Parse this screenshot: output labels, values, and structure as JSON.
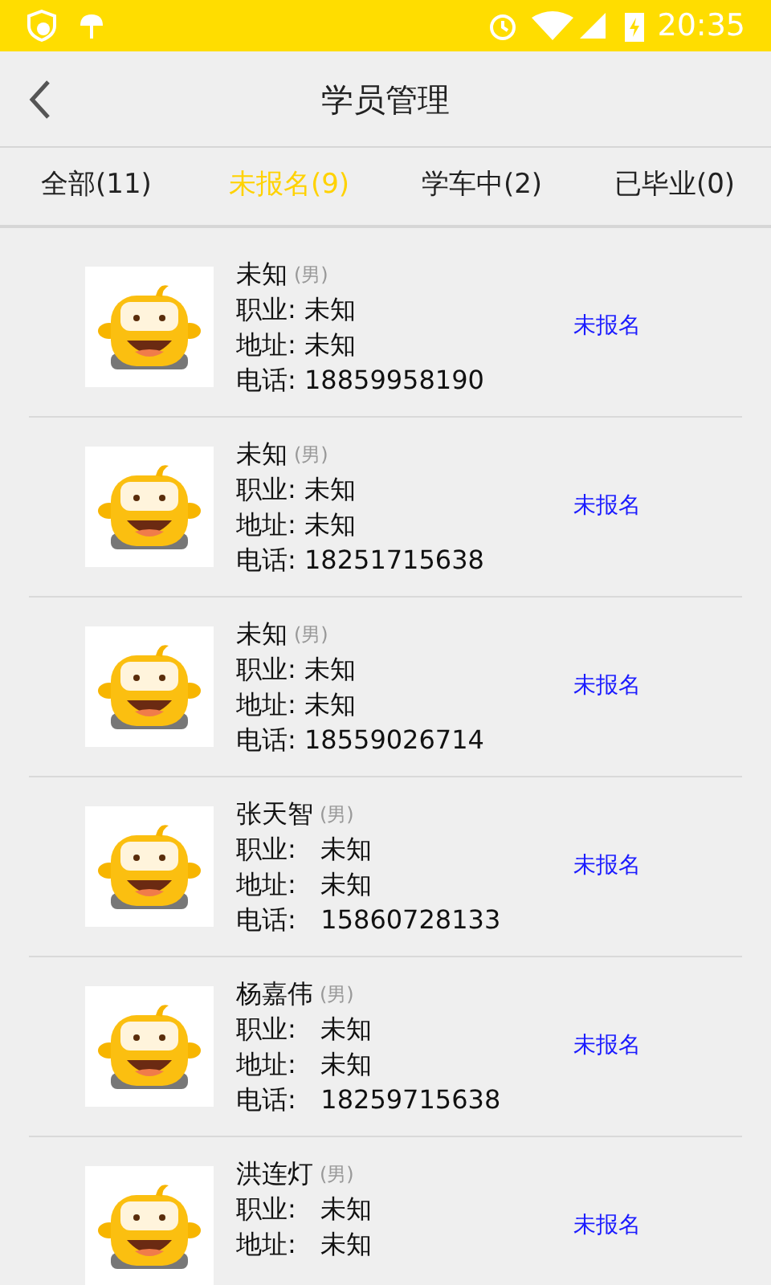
{
  "status_bar": {
    "time": "20:35"
  },
  "header": {
    "title": "学员管理"
  },
  "tabs": [
    {
      "label": "全部(11)",
      "selected": false
    },
    {
      "label": "未报名(9)",
      "selected": true
    },
    {
      "label": "学车中(2)",
      "selected": false
    },
    {
      "label": "已毕业(0)",
      "selected": false
    }
  ],
  "students": [
    {
      "name": "未知",
      "gender": "(男)",
      "occupation": "职业: 未知",
      "address": "地址: 未知",
      "phone": "电话: 18859958190",
      "status": "未报名"
    },
    {
      "name": "未知",
      "gender": "(男)",
      "occupation": "职业: 未知",
      "address": "地址: 未知",
      "phone": "电话: 18251715638",
      "status": "未报名"
    },
    {
      "name": "未知",
      "gender": "(男)",
      "occupation": "职业: 未知",
      "address": "地址: 未知",
      "phone": "电话: 18559026714",
      "status": "未报名"
    },
    {
      "name": "张天智",
      "gender": "(男)",
      "occupation": "职业:   未知",
      "address": "地址:   未知",
      "phone": "电话:   15860728133",
      "status": "未报名"
    },
    {
      "name": "杨嘉伟",
      "gender": "(男)",
      "occupation": "职业:   未知",
      "address": "地址:   未知",
      "phone": "电话:   18259715638",
      "status": "未报名"
    },
    {
      "name": "洪连灯",
      "gender": "(男)",
      "occupation": "职业:   未知",
      "address": "地址:   未知",
      "status": "未报名"
    }
  ]
}
